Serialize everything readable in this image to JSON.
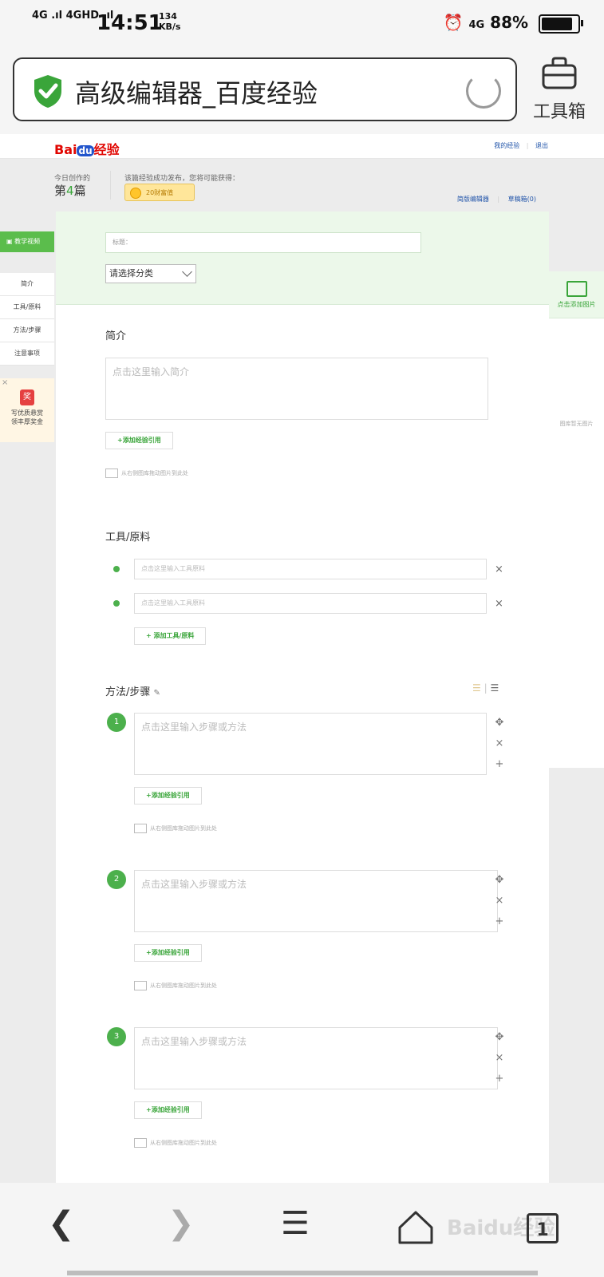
{
  "status_bar": {
    "signal_left": "4G .ıl 4GHD .ıl",
    "time": "14:51",
    "speed_value": "134",
    "speed_unit": "KB/s",
    "right_network": "4G",
    "battery": "88%"
  },
  "browser": {
    "title": "高级编辑器_百度经验",
    "toolbox_label": "工具箱"
  },
  "baidu": {
    "logo_bai": "Bai",
    "logo_du": "du",
    "logo_jy": "经验",
    "top_links": [
      "我的经验",
      "退出"
    ]
  },
  "header": {
    "today_label": "今日创作的",
    "count_prefix": "第",
    "count_num": "4",
    "count_suffix": "篇",
    "publish_note": "该篇经验成功发布，您将可能获得：",
    "coin_label": "20财富值",
    "editor_links": [
      "简版编辑器",
      "草稿箱(0)"
    ]
  },
  "sidebar": {
    "video_tab": "教学视频",
    "items": [
      "简介",
      "工具/原料",
      "方法/步骤",
      "注意事项"
    ],
    "reward_badge": "奖",
    "reward_line1": "写优质悬赏",
    "reward_line2": "领丰厚奖金"
  },
  "form": {
    "title_placeholder": "标题：",
    "category_select": "请选择分类",
    "intro_title": "简介",
    "intro_placeholder": "点击这里输入简介",
    "add_reference": "+添加经验引用",
    "drag_hint": "从右侧图库拖动图片到此处",
    "tools_title": "工具/原料",
    "tool_placeholder": "点击这里输入工具原料",
    "add_tool": "+ 添加工具/原料",
    "steps_title": "方法/步骤",
    "step_placeholder": "点击这里输入步骤或方法",
    "steps": [
      "1",
      "2",
      "3"
    ]
  },
  "right_panel": {
    "add_image": "点击添加图片",
    "no_image": "图库暂无图片"
  },
  "nav": {
    "tab_count": "1",
    "watermark": "Baidu经验"
  }
}
